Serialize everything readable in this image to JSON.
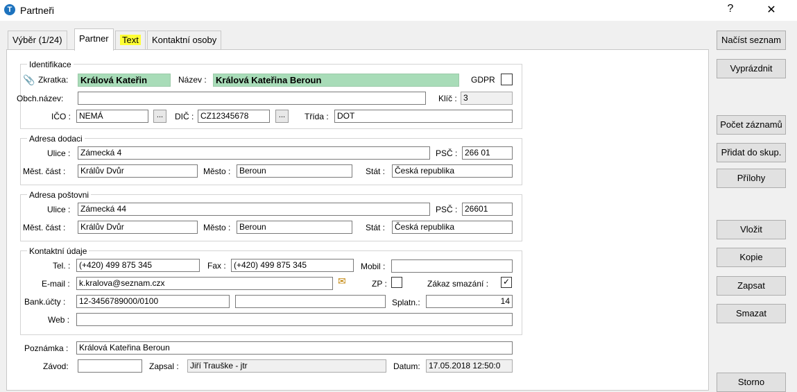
{
  "window": {
    "title": "Partneři",
    "help": "?",
    "close": "✕",
    "icon_letter": "T"
  },
  "tabs": [
    "Výběr (1/24)",
    "Partner",
    "Text",
    "Kontaktní osoby"
  ],
  "identifikace": {
    "legend": "Identifikace",
    "zkratka_label": "Zkratka:",
    "zkratka": "Králová Kateřin",
    "nazev_label": "Název :",
    "nazev": "Králová Kateřina Beroun",
    "gdpr_label": "GDPR",
    "obch_label": "Obch.název:",
    "obch": "",
    "klic_label": "Klíč :",
    "klic": "3",
    "ico_label": "IČO :",
    "ico": "NEMÁ",
    "dic_label": "DIČ :",
    "dic": "CZ12345678",
    "trida_label": "Třída :",
    "trida": "DOT",
    "ellipsis": "..."
  },
  "dodaci": {
    "legend": "Adresa dodaci",
    "ulice_label": "Ulice :",
    "ulice": "Zámecká 4",
    "psc_label": "PSČ :",
    "psc": "266 01",
    "cast_label": "Měst. část :",
    "cast": "Králův Dvůr",
    "mesto_label": "Město :",
    "mesto": "Beroun",
    "stat_label": "Stát :",
    "stat": "Česká republika"
  },
  "postovni": {
    "legend": "Adresa poštovni",
    "ulice_label": "Ulice :",
    "ulice": "Zámecká 44",
    "psc_label": "PSČ :",
    "psc": "26601",
    "cast_label": "Měst. část :",
    "cast": "Králův Dvůr",
    "mesto_label": "Město :",
    "mesto": "Beroun",
    "stat_label": "Stát :",
    "stat": "Česká republika"
  },
  "kontakt": {
    "legend": "Kontaktní údaje",
    "tel_label": "Tel. :",
    "tel": "(+420) 499 875 345",
    "fax_label": "Fax :",
    "fax": "(+420) 499 875 345",
    "mobil_label": "Mobil :",
    "mobil": "",
    "email_label": "E-mail :",
    "email": "k.kralova@seznam.czx",
    "zp_label": "ZP :",
    "zakaz_label": "Zákaz smazání :",
    "zakaz_mark": "✓",
    "bank_label": "Bank.účty :",
    "bank1": "12-3456789000/0100",
    "bank2": "",
    "splatn_label": "Splatn.:",
    "splatn": "14",
    "web_label": "Web :",
    "web": ""
  },
  "footer": {
    "poznamka_label": "Poznámka :",
    "poznamka": "Králová Kateřina   Beroun",
    "zavod_label": "Závod:",
    "zavod": "",
    "zapsal_label": "Zapsal :",
    "zapsal": "Jiří Trauške - jtr",
    "datum_label": "Datum:",
    "datum": "17.05.2018 12:50:0"
  },
  "side_buttons": [
    "Načíst seznam",
    "Vyprázdnit",
    "Počet záznamů",
    "Přidat do skup.",
    "Přílohy",
    "Vložit",
    "Kopie",
    "Zapsat",
    "Smazat",
    "Storno"
  ]
}
